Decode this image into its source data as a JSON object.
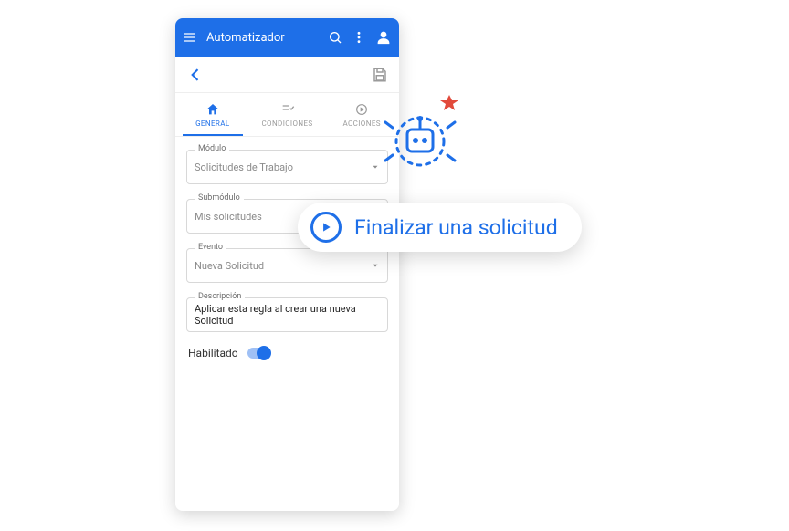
{
  "appbar": {
    "title": "Automatizador"
  },
  "tabs": {
    "general": {
      "label": "GENERAL"
    },
    "condiciones": {
      "label": "CONDICIONES"
    },
    "acciones": {
      "label": "ACCIONES"
    }
  },
  "fields": {
    "modulo": {
      "label": "Módulo",
      "value": "Solicitudes de Trabajo"
    },
    "submodulo": {
      "label": "Submódulo",
      "value": "Mis solicitudes"
    },
    "evento": {
      "label": "Evento",
      "value": "Nueva Solicitud"
    },
    "descripcion": {
      "label": "Descripción",
      "value": "Aplicar esta regla al crear una nueva Solicitud"
    }
  },
  "toggle": {
    "label": "Habilitado",
    "enabled": true
  },
  "callout": {
    "text": "Finalizar una solicitud"
  },
  "colors": {
    "primary": "#1e6fe8",
    "accent": "#e24a3b"
  }
}
